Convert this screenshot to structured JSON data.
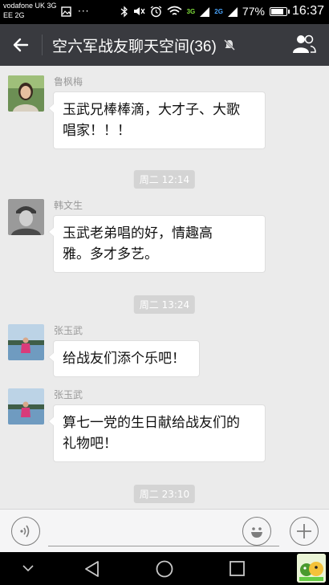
{
  "status_bar": {
    "carrier_line1": "vodafone UK 3G",
    "carrier_line2": "EE 2G",
    "net1": "3G",
    "net2": "2G",
    "battery": "77%",
    "time": "16:37",
    "icons": [
      "image-icon",
      "more-icon",
      "bluetooth-icon",
      "mute-icon",
      "alarm-icon",
      "wifi-icon",
      "signal-icon",
      "battery-icon"
    ]
  },
  "header": {
    "back_icon": "back-arrow-icon",
    "title": "空六军战友聊天空间(36)",
    "mute_icon": "notifications-off-icon",
    "members_icon": "group-members-icon"
  },
  "messages": [
    {
      "sender": "鲁枫梅",
      "text_line1": "玉武兄棒棒滴，大才子、大歌",
      "text_line2": "唱家！！！"
    },
    {
      "timestamp": "周二 12:14"
    },
    {
      "sender": "韩文生",
      "text_line1": "玉武老弟唱的好，情趣高",
      "text_line2": "雅。多才多艺。"
    },
    {
      "timestamp": "周二 13:24"
    },
    {
      "sender": "张玉武",
      "text_line1": "给战友们添个乐吧！"
    },
    {
      "sender": "张玉武",
      "text_line1": "算七一党的生日献给战友们的",
      "text_line2": "礼物吧！"
    },
    {
      "timestamp": "周二 23:10"
    }
  ],
  "input_bar": {
    "voice_icon": "voice-input-icon",
    "emoji_icon": "emoji-icon",
    "plus_icon": "more-actions-icon"
  },
  "nav_bar": {
    "icons": [
      "collapse-icon",
      "back-nav-icon",
      "home-icon",
      "recents-icon"
    ]
  },
  "colors": {
    "header_bg": "#393a3f",
    "chat_bg": "#ebebeb",
    "bubble_bg": "#ffffff",
    "timestamp_bg": "#d4d4d4"
  }
}
